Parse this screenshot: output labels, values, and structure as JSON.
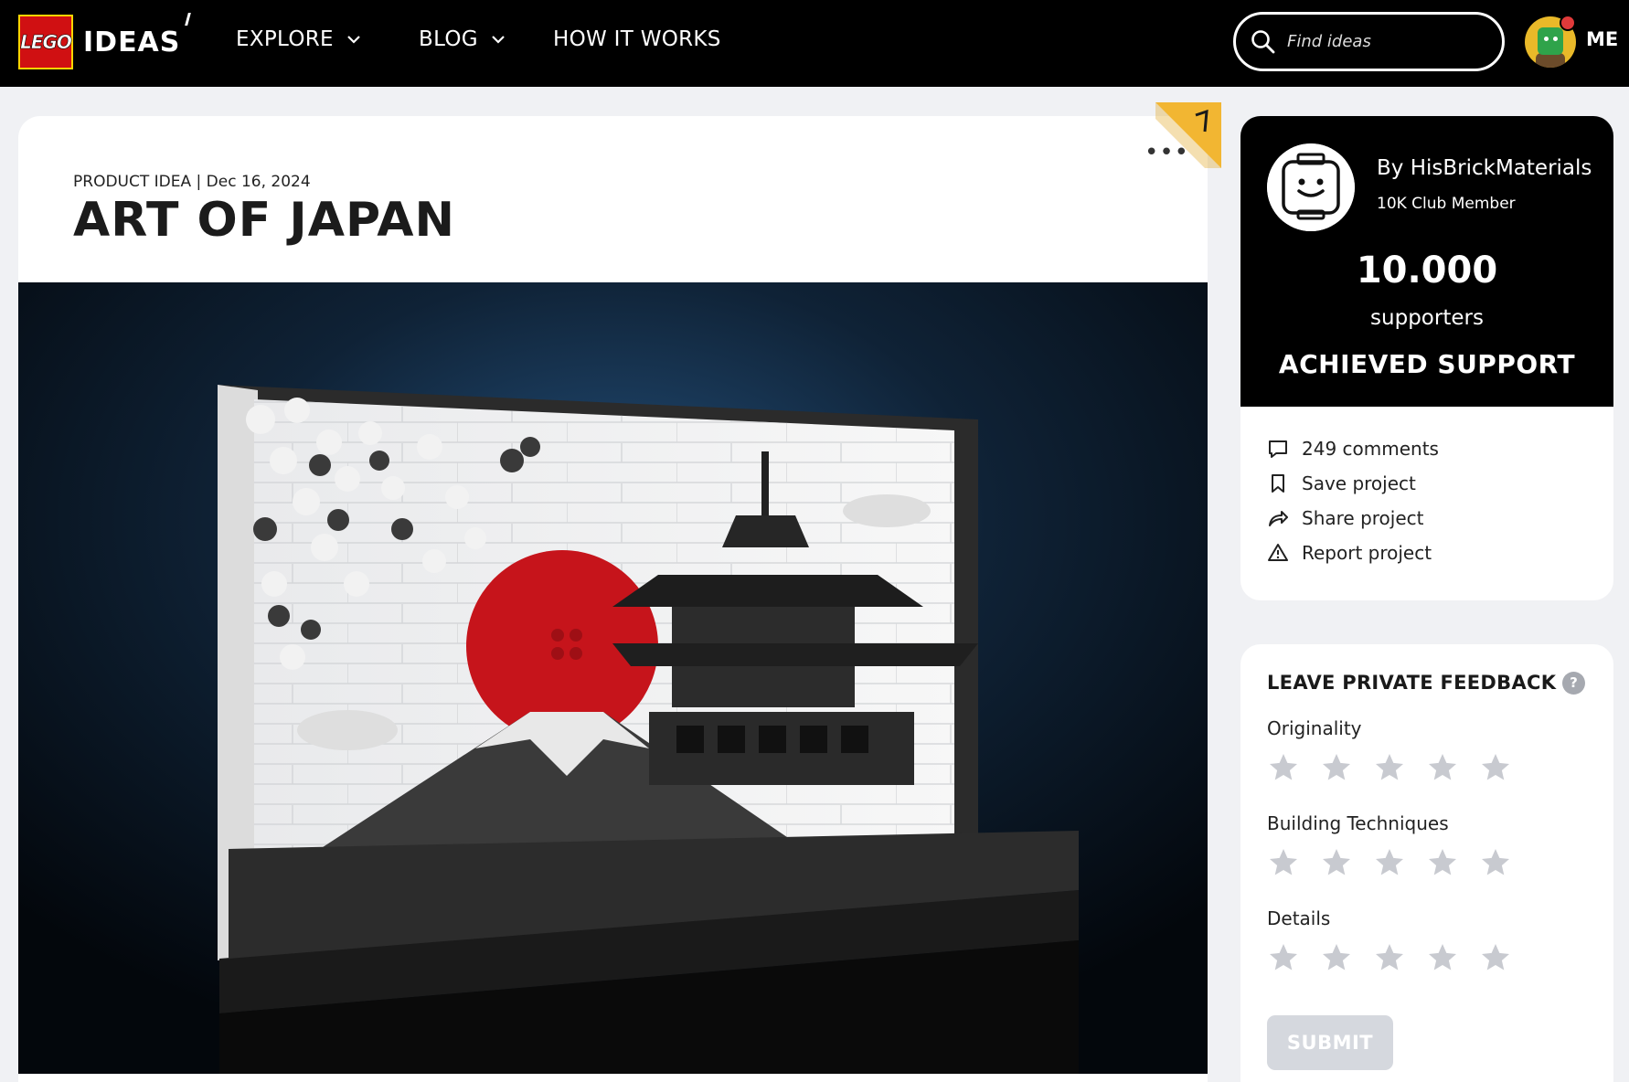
{
  "header": {
    "logo_text": "LEGO",
    "brand": "IDEAS",
    "nav": [
      {
        "label": "EXPLORE",
        "has_dropdown": true,
        "icon": "chevron-down-icon"
      },
      {
        "label": "BLOG",
        "has_dropdown": true,
        "icon": "chevron-down-icon"
      },
      {
        "label": "HOW IT WORKS",
        "has_dropdown": false
      }
    ],
    "search_placeholder": "Find ideas",
    "user_label": "ME"
  },
  "idea": {
    "meta": "PRODUCT IDEA | Dec 16, 2024",
    "title": "ART OF JAPAN",
    "more_icon": "ellipsis-icon",
    "image_alt": "LEGO build: Japanese art diorama with rising sun, cherry blossoms, pagoda, Mount Fuji and clouds"
  },
  "author": {
    "name": "By HisBrickMaterials",
    "badge": "10K Club Member",
    "supporters_count": "10.000",
    "supporters_label": "supporters",
    "status": "ACHIEVED SUPPORT"
  },
  "actions": [
    {
      "label": "249 comments",
      "icon": "comment-icon"
    },
    {
      "label": "Save project",
      "icon": "bookmark-icon"
    },
    {
      "label": "Share project",
      "icon": "share-icon"
    },
    {
      "label": "Report project",
      "icon": "warning-icon"
    }
  ],
  "feedback": {
    "title": "LEAVE PRIVATE FEEDBACK",
    "help_icon": "?",
    "ratings": [
      {
        "label": "Originality",
        "stars": 5,
        "value": 0
      },
      {
        "label": "Building Techniques",
        "stars": 5,
        "value": 0
      },
      {
        "label": "Details",
        "stars": 5,
        "value": 0
      }
    ],
    "submit_label": "SUBMIT"
  },
  "colors": {
    "nav_bg": "#000000",
    "lego_red": "#d01012",
    "star_inactive": "#c8cad0",
    "submit_disabled": "#d5d8de"
  }
}
